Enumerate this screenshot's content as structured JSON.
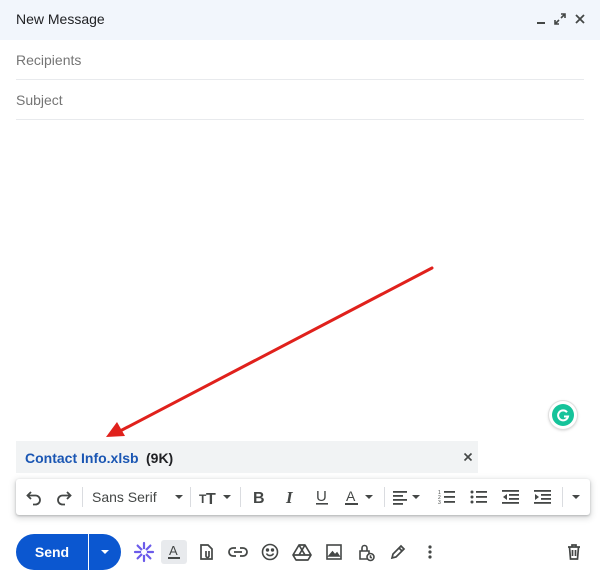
{
  "window": {
    "title": "New Message"
  },
  "fields": {
    "recipients_placeholder": "Recipients",
    "subject_placeholder": "Subject"
  },
  "attachment": {
    "name": "Contact Info.xlsb",
    "size": "(9K)"
  },
  "format_bar": {
    "font_name": "Sans Serif"
  },
  "send": {
    "label": "Send"
  },
  "colors": {
    "header_bg": "#f2f6fc",
    "send_blue": "#0b57d0",
    "attachment_link": "#1a56b3",
    "annotation_arrow": "#e0211c",
    "grammarly_green": "#15c39a"
  },
  "icons": {
    "header": [
      "minimize-icon",
      "expand-icon",
      "close-icon"
    ],
    "format": [
      "undo-icon",
      "redo-icon",
      "font-dropdown",
      "text-size-icon",
      "bold-icon",
      "italic-icon",
      "underline-icon",
      "text-color-icon",
      "align-icon",
      "numbered-list-icon",
      "bulleted-list-icon",
      "indent-less-icon",
      "indent-more-icon",
      "more-formatting-icon"
    ],
    "bottom": [
      "ai-sparkle-icon",
      "formatting-options-icon",
      "attach-file-icon",
      "insert-link-icon",
      "emoji-icon",
      "google-drive-icon",
      "insert-photo-icon",
      "confidential-mode-icon",
      "signature-icon",
      "more-options-icon",
      "discard-draft-icon"
    ]
  }
}
